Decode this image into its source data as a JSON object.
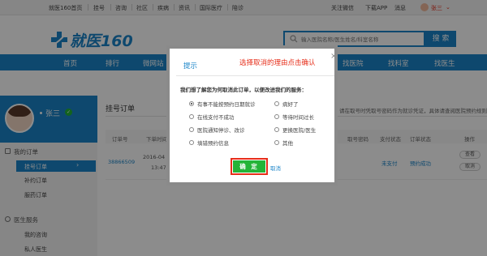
{
  "topbar": {
    "home": "就医160首页",
    "links": [
      "挂号",
      "咨询",
      "社区",
      "疾病",
      "资讯",
      "国际医疗",
      "陪诊"
    ],
    "wechat": "关注微信",
    "app": "下载APP",
    "messages": "消息",
    "username": "张三"
  },
  "header": {
    "logo_text": "就医160",
    "search_placeholder": "输入医院名称/医生姓名/科室名称",
    "search_button": "搜 索"
  },
  "nav": {
    "items": [
      "首页",
      "排行",
      "微网站",
      "找医院",
      "找科室",
      "找医生"
    ]
  },
  "sidebar": {
    "username": "张三",
    "my_orders": "我的订单",
    "items": [
      "挂号订单",
      "补约订单",
      "服药订单"
    ],
    "doctor_service": "医生服务",
    "doctor_items": [
      "我的咨询",
      "私人医生"
    ]
  },
  "main": {
    "title": "挂号订单",
    "notice": "请在取号时凭取号密码作为就诊凭证，具体请查阅医院预约规则。",
    "headers": [
      "订单号",
      "下单时间",
      "取号密码",
      "支付状态",
      "订单状态",
      "操作"
    ],
    "row": {
      "order_no": "38866509",
      "date": "2016-04",
      "time": "13:47:5",
      "pay_status": "未支付",
      "order_status": "预约成功",
      "actions": [
        "查看",
        "取消"
      ]
    }
  },
  "dialog": {
    "title": "提示",
    "annotation": "选择取消的理由点击确认",
    "close": "×",
    "prompt": "我们想了解您为何取消此订单，以便改进我们的服务：",
    "options_left": [
      "有事不能按预约日期就诊",
      "在线支付不成功",
      "医院通知停诊、改诊",
      "填错预约信息"
    ],
    "options_right": [
      "病好了",
      "等待时间过长",
      "更换医院/医生",
      "其他"
    ],
    "selected_index": 0,
    "confirm": "确 定",
    "cancel": "取消"
  },
  "colors": {
    "brand_blue": "#1a84c8",
    "confirm_green": "#24b438",
    "annotation_red": "#e62e1a"
  }
}
